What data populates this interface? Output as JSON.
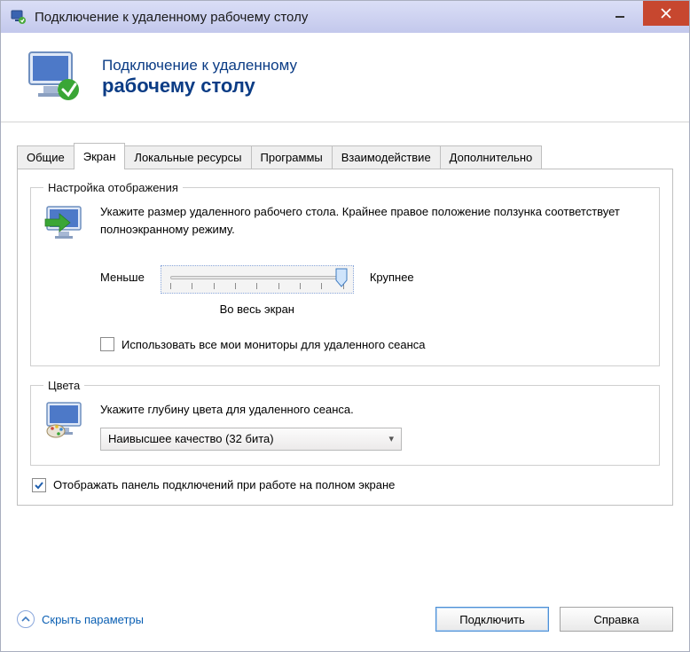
{
  "window": {
    "title": "Подключение к удаленному рабочему столу"
  },
  "header": {
    "line1": "Подключение к удаленному",
    "line2": "рабочему столу"
  },
  "tabs": {
    "general": "Общие",
    "screen": "Экран",
    "local": "Локальные ресурсы",
    "programs": "Программы",
    "experience": "Взаимодействие",
    "advanced": "Дополнительно"
  },
  "display_group": {
    "legend": "Настройка отображения",
    "desc": "Укажите размер удаленного рабочего стола. Крайнее правое положение ползунка соответствует полноэкранному режиму.",
    "less": "Меньше",
    "more": "Крупнее",
    "fullscreen": "Во весь экран",
    "use_all_monitors": "Использовать все мои мониторы для удаленного сеанса"
  },
  "colors_group": {
    "legend": "Цвета",
    "desc": "Укажите глубину цвета для удаленного сеанса.",
    "combo_value": "Наивысшее качество (32 бита)"
  },
  "bottom": {
    "show_bar": "Отображать панель подключений при работе на полном экране"
  },
  "footer": {
    "collapse": "Скрыть параметры",
    "connect": "Подключить",
    "help": "Справка"
  }
}
